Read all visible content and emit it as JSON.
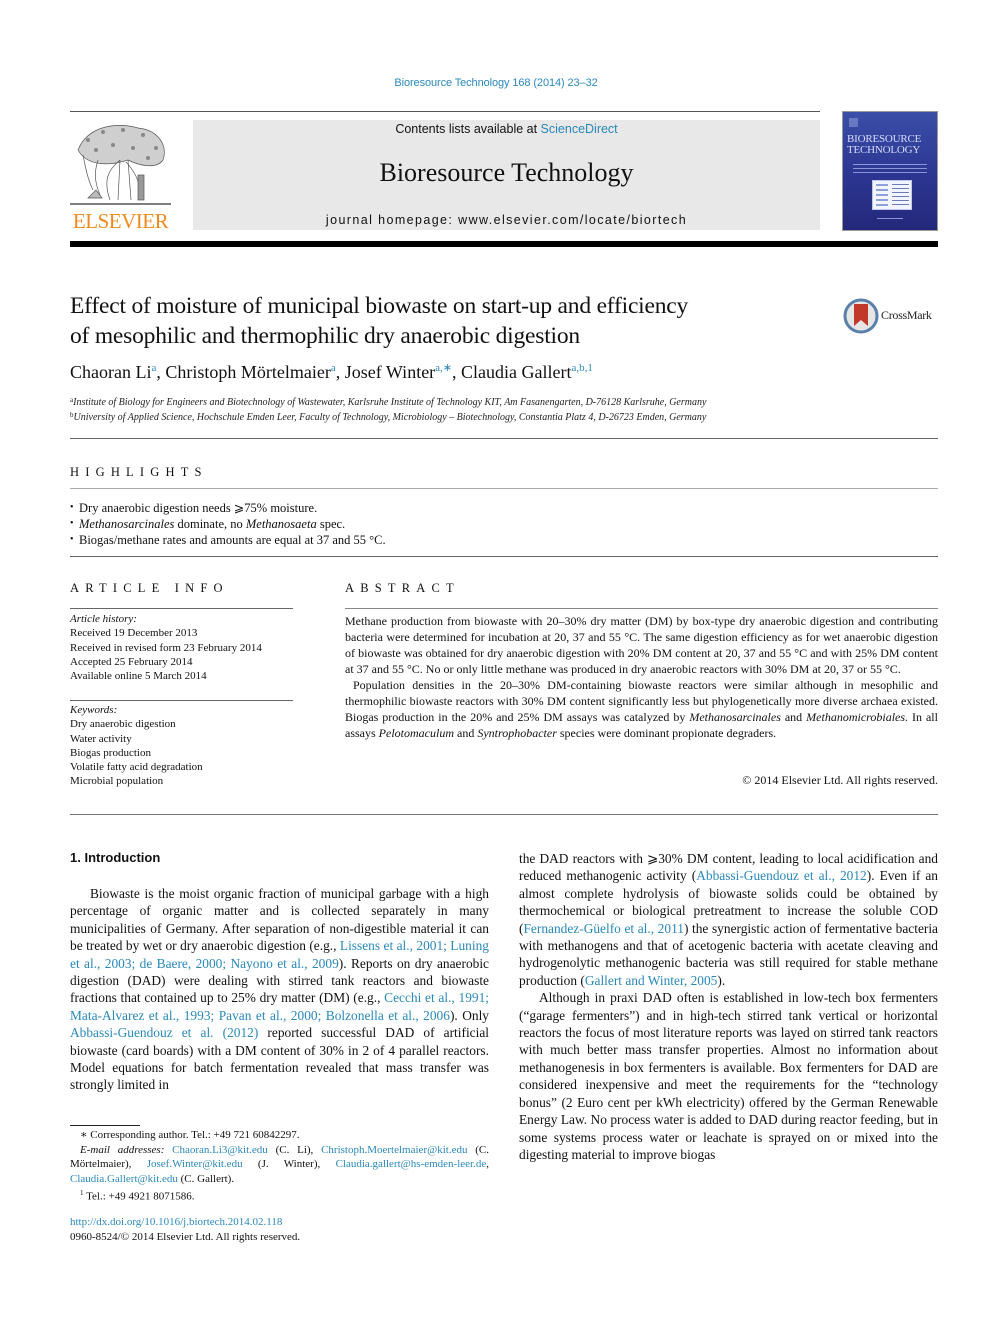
{
  "header": {
    "journal_reference": "Bioresource Technology 168 (2014) 23–32",
    "contents_prefix": "Contents lists available at ",
    "contents_link": "ScienceDirect",
    "journal_title": "Bioresource Technology",
    "homepage": "journal homepage: www.elsevier.com/locate/biortech",
    "publisher_logo_text": "ELSEVIER",
    "cover_title_line1": "BIORESOURCE",
    "cover_title_line2": "TECHNOLOGY",
    "colors": {
      "link": "#2a88b8",
      "elsevier_orange": "#f08a1e",
      "banner_bg": "#e8e8e8",
      "cover_blue": "#2c3691",
      "crossmark_red": "#c0392b"
    }
  },
  "article": {
    "title_line1": "Effect of moisture of municipal biowaste on start-up and efficiency",
    "title_line2": "of mesophilic and thermophilic dry anaerobic digestion",
    "crossmark_label": "CrossMark",
    "authors": [
      {
        "name": "Chaoran Li",
        "sup": "a"
      },
      {
        "name": "Christoph Mörtelmaier",
        "sup": "a"
      },
      {
        "name": "Josef Winter",
        "sup": "a,∗"
      },
      {
        "name": "Claudia Gallert",
        "sup": "a,b,1"
      }
    ],
    "affiliations": [
      {
        "mark": "a",
        "text": "Institute of Biology for Engineers and Biotechnology of Wastewater, Karlsruhe Institute of Technology KIT, Am Fasanengarten, D-76128 Karlsruhe, Germany"
      },
      {
        "mark": "b",
        "text": "University of Applied Science, Hochschule Emden Leer, Faculty of Technology, Microbiology – Biotechnology, Constantia Platz 4, D-26723 Emden, Germany"
      }
    ]
  },
  "highlights": {
    "heading": "HIGHLIGHTS",
    "item1": "Dry anaerobic digestion needs ⩾75% moisture.",
    "item2_a": "Methanosarcinales",
    "item2_b": " dominate, no ",
    "item2_c": "Methanosaeta",
    "item2_d": " spec.",
    "item3": "Biogas/methane rates and amounts are equal at 37 and 55 °C."
  },
  "article_info": {
    "heading": "ARTICLE INFO",
    "history_label": "Article history:",
    "history": [
      "Received 19 December 2013",
      "Received in revised form 23 February 2014",
      "Accepted 25 February 2014",
      "Available online 5 March 2014"
    ],
    "keywords_label": "Keywords:",
    "keywords": [
      "Dry anaerobic digestion",
      "Water activity",
      "Biogas production",
      "Volatile fatty acid degradation",
      "Microbial population"
    ]
  },
  "abstract": {
    "heading": "ABSTRACT",
    "p1": "Methane production from biowaste with 20–30% dry matter (DM) by box-type dry anaerobic digestion and contributing bacteria were determined for incubation at 20, 37 and 55 °C. The same digestion efficiency as for wet anaerobic digestion of biowaste was obtained for dry anaerobic digestion with 20% DM content at 20, 37 and 55 °C and with 25% DM content at 37 and 55 °C. No or only little methane was produced in dry anaerobic reactors with 30% DM at 20, 37 or 55 °C.",
    "p2_a": "Population densities in the 20–30% DM-containing biowaste reactors were similar although in mesophilic and thermophilic biowaste reactors with 30% DM content significantly less but phylogenetically more diverse archaea existed. Biogas production in the 20% and 25% DM assays was catalyzed by ",
    "p2_i1": "Methanosarcinales",
    "p2_b": " and ",
    "p2_i2": "Methanomicrobiales",
    "p2_c": ". In all assays ",
    "p2_i3": "Pelotomaculum",
    "p2_d": " and ",
    "p2_i4": "Syntrophobacter",
    "p2_e": " species were dominant propionate degraders.",
    "copyright": "© 2014 Elsevier Ltd. All rights reserved."
  },
  "body": {
    "section_heading": "1. Introduction",
    "left_p1": [
      {
        "t": "Biowaste is the moist organic fraction of municipal garbage with a high percentage of organic matter and is collected separately in many municipalities of Germany. After separation of non-digestible material it can be treated by wet or dry anaerobic digestion (e.g., "
      },
      {
        "link": "Lissens et al., 2001; Luning et al., 2003; de Baere, 2000; Nayono et al., 2009"
      },
      {
        "t": "). Reports on dry anaerobic digestion (DAD) were dealing with stirred tank reactors and biowaste fractions that contained up to 25% dry matter (DM) (e.g., "
      },
      {
        "link": "Cecchi et al., 1991; Mata-Alvarez et al., 1993; Pavan et al., 2000; Bolzonella et al., 2006"
      },
      {
        "t": "). Only "
      },
      {
        "link": "Abbassi-Guendouz et al. (2012)"
      },
      {
        "t": " reported successful DAD of artificial biowaste (card boards) with a DM content of 30% in 2 of 4 parallel reactors. Model equations for batch fermentation revealed that mass transfer was strongly limited in"
      }
    ],
    "right_p1": [
      {
        "t": "the DAD reactors with ⩾30% DM content, leading to local acidification and reduced methanogenic activity ("
      },
      {
        "link": "Abbassi-Guendouz et al., 2012"
      },
      {
        "t": "). Even if an almost complete hydrolysis of biowaste solids could be obtained by thermochemical or biological pretreatment to increase the soluble COD ("
      },
      {
        "link": "Fernandez-Güelfo et al., 2011"
      },
      {
        "t": ") the synergistic action of fermentative bacteria with methanogens and that of acetogenic bacteria with acetate cleaving and hydrogenolytic methanogenic bacteria was still required for stable methane production ("
      },
      {
        "link": "Gallert and Winter, 2005"
      },
      {
        "t": ")."
      }
    ],
    "right_p2": "Although in praxi DAD often is established in low-tech box fermenters (“garage fermenters”) and in high-tech stirred tank vertical or horizontal reactors the focus of most literature reports was layed on stirred tank reactors with much better mass transfer properties. Almost no information about methanogenesis in box fermenters is available. Box fermenters for DAD are considered inexpensive and meet the requirements for the “technology bonus” (2 Euro cent per kWh electricity) offered by the German Renewable Energy Law. No process water is added to DAD during reactor feeding, but in some systems process water or leachate is sprayed on or mixed into the digesting material to improve biogas"
  },
  "footnotes": {
    "corresponding": "∗  Corresponding author. Tel.: +49 721 60842297.",
    "email_label": "E-mail addresses:",
    "emails": [
      {
        "address": "Chaoran.Li3@kit.edu",
        "owner": " (C. Li), "
      },
      {
        "address": "Christoph.Moertelmaier@kit.edu",
        "owner": " (C. Mörtelmaier), "
      },
      {
        "address": "Josef.Winter@kit.edu",
        "owner": " (J. Winter), "
      },
      {
        "address": "Claudia.gallert@hs-emden-leer.de",
        "owner": ", "
      },
      {
        "address": "Claudia.Gallert@kit.edu",
        "owner": " (C. Gallert)."
      }
    ],
    "note1_mark": "1",
    "note1": "Tel.: +49 4921 8071586.",
    "doi": "http://dx.doi.org/10.1016/j.biortech.2014.02.118",
    "issn": "0960-8524/© 2014 Elsevier Ltd. All rights reserved."
  }
}
